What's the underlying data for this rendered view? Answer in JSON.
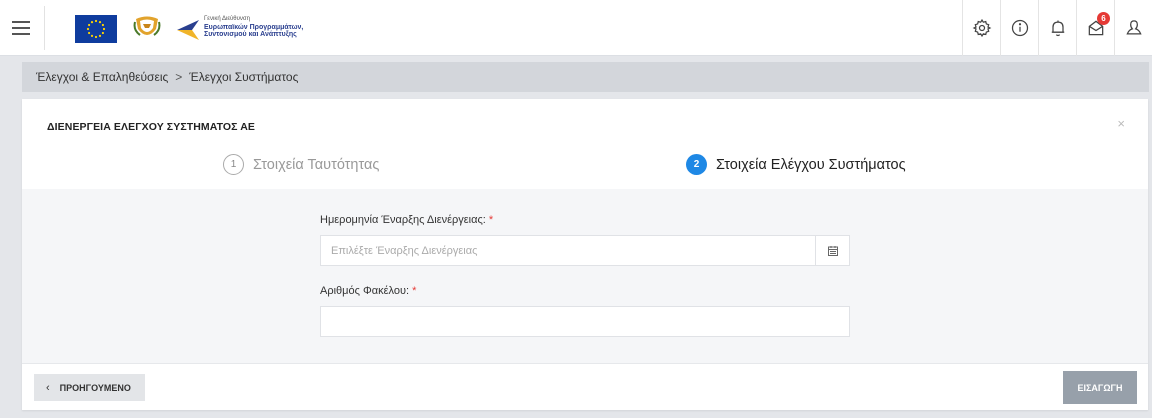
{
  "header": {
    "agency_logo_lines": [
      "Γενική Διεύθυνση",
      "Ευρωπαϊκών Προγραμμάτων,",
      "Συντονισμού και Ανάπτυξης"
    ],
    "icons": [
      "menu-icon",
      "gear-icon",
      "info-icon",
      "bell-icon",
      "mail-icon",
      "user-icon"
    ],
    "notifications_count": "6"
  },
  "breadcrumb": {
    "items": [
      "Έλεγχοι & Επαληθεύσεις",
      "Έλεγχοι Συστήματος"
    ],
    "separator": ">"
  },
  "modal": {
    "title": "ΔΙΕΝΕΡΓΕΙΑ ΕΛΕΓΧΟΥ ΣΥΣΤΗΜΑΤΟΣ ΑΕ",
    "close": "×",
    "steps": [
      {
        "number": "1",
        "label": "Στοιχεία Ταυτότητας",
        "active": false
      },
      {
        "number": "2",
        "label": "Στοιχεία Ελέγχου Συστήματος",
        "active": true
      }
    ],
    "fields": [
      {
        "label": "Ημερομηνία Έναρξης Διενέργειας:",
        "required": "*",
        "placeholder": "Επιλέξτε Έναρξης Διενέργειας",
        "value": ""
      },
      {
        "label": "Αριθμός Φακέλου:",
        "required": "*",
        "placeholder": "",
        "value": ""
      }
    ],
    "prev_button": "ΠΡΟΗΓΟΥΜΕΝΟ",
    "prev_chevron": "‹",
    "submit_button": "ΕΙΣΑΓΩΓΗ"
  },
  "colors": {
    "accent": "#1e88e5",
    "badge": "#e53935",
    "submit_bg": "#97a0aa",
    "breadcrumb_bg": "#d3d6db"
  }
}
